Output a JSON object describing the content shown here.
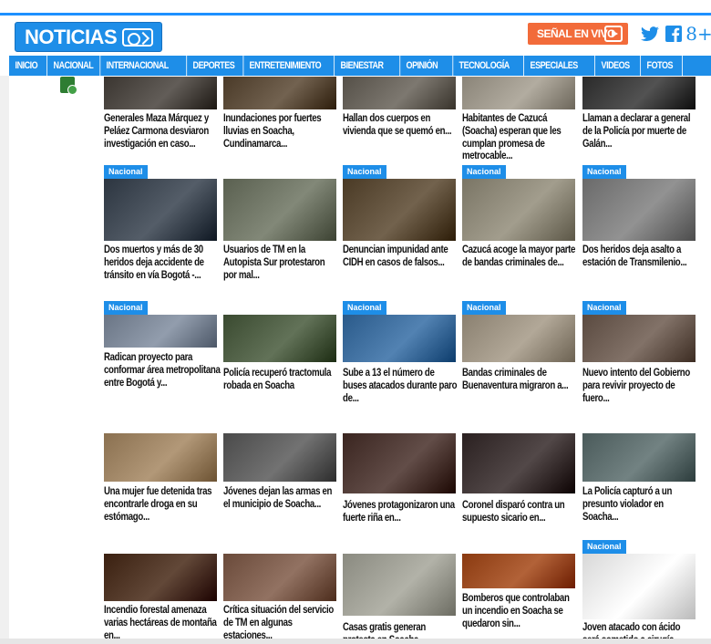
{
  "header": {
    "logo_text": "NOTICIAS",
    "live_label": "SEÑAL EN VIVO",
    "social": [
      "twitter-icon",
      "facebook-icon",
      "google-plus-icon"
    ],
    "social_glyphs": [
      "🐦",
      "f",
      "8+"
    ]
  },
  "nav": {
    "items": [
      "INICIO",
      "NACIONAL",
      "INTERNACIONAL",
      "DEPORTES",
      "ENTRETENIMIENTO",
      "BIENESTAR",
      "OPINIÓN",
      "TECNOLOGÍA",
      "ESPECIALES",
      "VIDEOS",
      "FOTOS"
    ]
  },
  "colors": {
    "accent": "#1e8ee8",
    "live": "#f26b3a"
  },
  "tag_label": "Nacional",
  "rows": [
    [
      {
        "title": "Generales Maza Márquez y Peláez Carmona desviaron investigación en caso...",
        "tag": false,
        "img": "#3a3530"
      },
      {
        "title": "Inundaciones por fuertes lluvias en Soacha, Cundinamarca...",
        "tag": false,
        "img": "#4a3a28"
      },
      {
        "title": "Hallan dos cuerpos en vivienda que se quemó en...",
        "tag": false,
        "img": "#555048"
      },
      {
        "title": "Habitantes de Cazucá (Soacha) esperan que les cumplan promesa de metrocable...",
        "tag": false,
        "img": "#8a8478"
      },
      {
        "title": "Llaman a declarar a general de la Policía por muerte de Galán...",
        "tag": false,
        "img": "#2a2a2a"
      }
    ],
    [
      {
        "title": "Dos muertos y más de 30 heridos deja accidente de tránsito en vía Bogotá -...",
        "tag": true,
        "img": "#2c3540"
      },
      {
        "title": "Usuarios de TM en la Autopista Sur protestaron por mal...",
        "tag": false,
        "img": "#5a6050"
      },
      {
        "title": "Denuncian impunidad ante CIDH en casos de falsos...",
        "tag": true,
        "img": "#4a3a25"
      },
      {
        "title": "Cazucá acoge la mayor parte de bandas criminales de...",
        "tag": true,
        "img": "#7a7565"
      },
      {
        "title": "Dos heridos deja asalto a estación de Transmilenio...",
        "tag": true,
        "img": "#6a6a6a"
      }
    ],
    [
      {
        "title": "Radican proyecto para conformar área metropolitana entre Bogotá y...",
        "tag": true,
        "img": "#6a7585"
      },
      {
        "title": "Policía recuperó tractomula robada en Soacha",
        "tag": false,
        "img": "#3a4a30"
      },
      {
        "title": "Sube a 13 el número de buses atacados durante paro de...",
        "tag": true,
        "img": "#2a5a8a"
      },
      {
        "title": "Bandas criminales de Buenaventura migraron a...",
        "tag": true,
        "img": "#8a8070"
      },
      {
        "title": "Nuevo intento del Gobierno para revivir proyecto de fuero...",
        "tag": true,
        "img": "#5a4a40"
      }
    ],
    [
      {
        "title": "Una mujer fue detenida tras encontrarle droga en su estómago...",
        "tag": false,
        "img": "#8a7050"
      },
      {
        "title": "Jóvenes dejan las armas en el municipio de Soacha...",
        "tag": false,
        "img": "#4a4a4a"
      },
      {
        "title": "Jóvenes protagonizaron una fuerte riña en...",
        "tag": false,
        "img": "#3a2520"
      },
      {
        "title": "Coronel disparó contra un supuesto sicario en...",
        "tag": false,
        "img": "#2a2020"
      },
      {
        "title": "La Policía capturó a un presunto violador en Soacha...",
        "tag": false,
        "img": "#4a5a5a"
      }
    ],
    [
      {
        "title": "Incendio forestal amenaza varias hectáreas de montaña en...",
        "tag": false,
        "img": "#3a2010"
      },
      {
        "title": "Crítica situación del servicio de TM en algunas estaciones...",
        "tag": false,
        "img": "#6a4a3a"
      },
      {
        "title": "Casas gratis generan protesta en Soacha...",
        "tag": false,
        "img": "#8a8a80"
      },
      {
        "title": "Bomberos que controlaban un incendio en Soacha se quedaron sin...",
        "tag": false,
        "img": "#8a3a10"
      },
      {
        "title": "Joven atacado con ácido será sometido a cirugía...",
        "tag": true,
        "img": "#d8d8d8"
      }
    ]
  ]
}
